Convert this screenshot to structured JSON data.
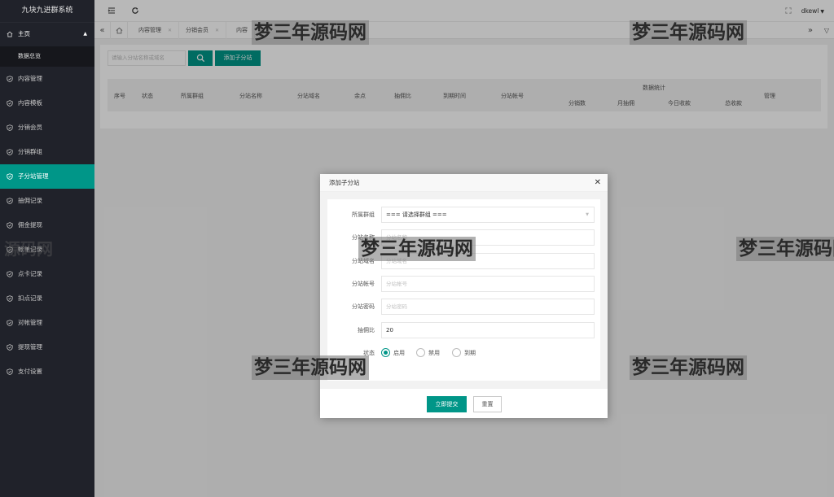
{
  "app": {
    "title": "九块九进群系统"
  },
  "sidebar": {
    "home": {
      "label": "主页",
      "sub": "数据总览"
    },
    "items": [
      {
        "label": "内容管理",
        "icon": "shield-icon"
      },
      {
        "label": "内容模板",
        "icon": "shield-icon"
      },
      {
        "label": "分销会员",
        "icon": "shield-icon"
      },
      {
        "label": "分销群组",
        "icon": "shield-icon"
      },
      {
        "label": "子分站管理",
        "icon": "shield-icon",
        "active": true
      },
      {
        "label": "抽佣记录",
        "icon": "shield-icon"
      },
      {
        "label": "佣金提现",
        "icon": "shield-icon"
      },
      {
        "label": "帐单记录",
        "icon": "shield-icon"
      },
      {
        "label": "点卡记录",
        "icon": "shield-icon"
      },
      {
        "label": "扣点记录",
        "icon": "shield-icon"
      },
      {
        "label": "对帐管理",
        "icon": "shield-icon"
      },
      {
        "label": "提现管理",
        "icon": "shield-icon"
      },
      {
        "label": "支付设置",
        "icon": "shield-icon"
      }
    ]
  },
  "header": {
    "user": "dkewl"
  },
  "tabs": [
    {
      "label": "内容管理"
    },
    {
      "label": "分销会员"
    },
    {
      "label": "内容"
    }
  ],
  "main": {
    "search_placeholder": "请输入分站名称或域名",
    "add_label": "添加子分站",
    "table": {
      "columns": [
        "序号",
        "状态",
        "所属群组",
        "分站名称",
        "分站域名",
        "余点",
        "抽佣比",
        "到期时间",
        "分站帐号"
      ],
      "group_header": "数据统计",
      "group_columns": [
        "分销数",
        "月抽佣",
        "今日收款",
        "总收款"
      ],
      "manage": "管理"
    }
  },
  "modal": {
    "title": "添加子分站",
    "fields": {
      "group": {
        "label": "所属群组",
        "value": "=== 请选择群组 ==="
      },
      "name": {
        "label": "分站名称",
        "placeholder": "分站名称"
      },
      "domain": {
        "label": "分站域名",
        "placeholder": "分站域名"
      },
      "account": {
        "label": "分站帐号",
        "placeholder": "分站帐号"
      },
      "password": {
        "label": "分站密码",
        "placeholder": "分站密码"
      },
      "ratio": {
        "label": "抽佣比",
        "value": "20"
      },
      "status": {
        "label": "状态",
        "options": [
          "启用",
          "禁用",
          "到期"
        ],
        "selected": "启用"
      }
    },
    "submit_label": "立即提交",
    "reset_label": "重置"
  },
  "watermark": {
    "text": "梦三年源码网",
    "faint": "源码网"
  },
  "colors": {
    "accent": "#009688",
    "sidebar_bg": "#20222a"
  }
}
